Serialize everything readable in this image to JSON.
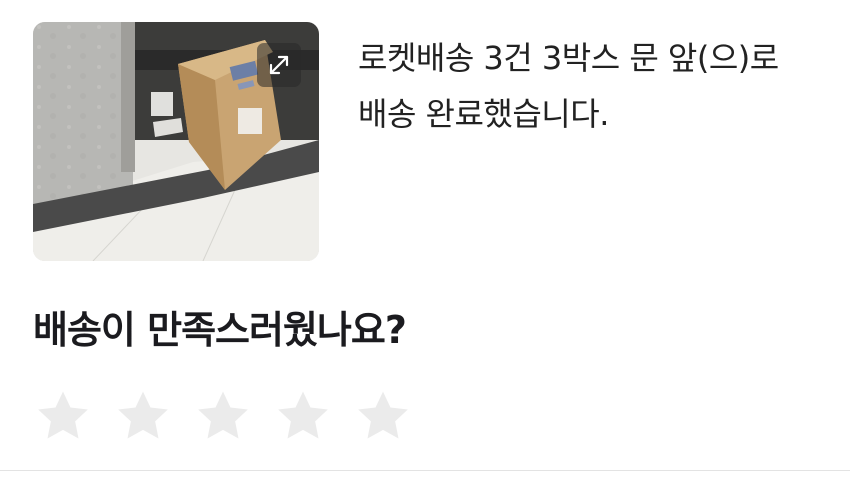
{
  "delivery": {
    "message": "로켓배송 3건 3박스 문 앞(으)로 배송 완료했습니다.",
    "photo_icon": "package-photo",
    "expand_icon": "expand-icon"
  },
  "rating": {
    "question": "배송이 만족스러웠나요?",
    "max_stars": 5,
    "selected_stars": 0,
    "star_color": "#ebebeb"
  }
}
